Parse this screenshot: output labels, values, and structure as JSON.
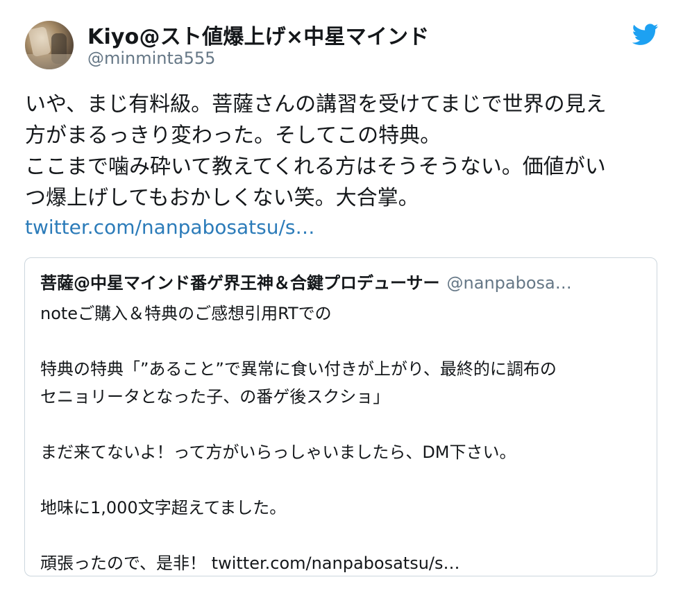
{
  "tweet": {
    "author": {
      "display_name": "Kiyo@スト値爆上げ×中星マインド",
      "handle": "@minminta555"
    },
    "text_lines": [
      "いや、まじ有料級。菩薩さんの講習を受けてまじで世界の見え",
      "方がまるっきり変わった。そしてこの特典。",
      "ここまで噛み砕いて教えてくれる方はそうそうない。価値がい",
      "つ爆上げしてもおかしくない笑。大合掌。"
    ],
    "link": "twitter.com/nanpabosatsu/s…",
    "brand_icon": "twitter-bird-icon",
    "brand_color": "#1da1f2",
    "link_color": "#2b7bb9"
  },
  "quoted_tweet": {
    "author_name": "菩薩@中星マインド番ゲ界王神＆合鍵プロデューサー",
    "author_handle": "@nanpabosa…",
    "lines": [
      "noteご購入＆特典のご感想引用RTでの",
      "",
      "特典の特典「”あること”で異常に食い付きが上がり、最終的に調布の",
      "セニョリータとなった子、の番ゲ後スクショ」",
      "",
      "まだ来てないよ！って方がいらっしゃいましたら、DM下さい。",
      "",
      "地味に1,000文字超えてました。",
      "",
      "頑張ったので、是非！ twitter.com/nanpabosatsu/s…"
    ]
  }
}
